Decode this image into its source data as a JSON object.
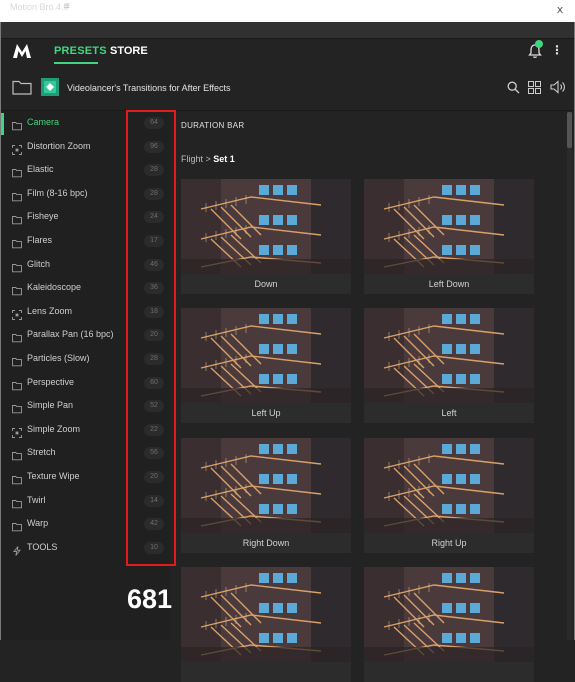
{
  "window": {
    "close_label": "x"
  },
  "panel": {
    "title": "Motion Bro 4.0",
    "menu_glyph": "≡"
  },
  "nav": {
    "logo_icon": "motion-bro-logo",
    "tabs": [
      {
        "label": "PRESETS",
        "active": true
      },
      {
        "label": "STORE",
        "active": false
      }
    ],
    "kebab_glyph": "⋮"
  },
  "product": {
    "title": "Videolancer's Transitions for After Effects"
  },
  "sidebar": {
    "items": [
      {
        "label": "Camera",
        "count": "64",
        "icon": "folder-icon",
        "active": true
      },
      {
        "label": "Distortion Zoom",
        "count": "96",
        "icon": "zoom-frame-icon"
      },
      {
        "label": "Elastic",
        "count": "28",
        "icon": "folder-icon"
      },
      {
        "label": "Film (8-16 bpc)",
        "count": "28",
        "icon": "folder-icon"
      },
      {
        "label": "Fisheye",
        "count": "24",
        "icon": "folder-icon"
      },
      {
        "label": "Flares",
        "count": "17",
        "icon": "folder-icon"
      },
      {
        "label": "Glitch",
        "count": "46",
        "icon": "folder-icon"
      },
      {
        "label": "Kaleidoscope",
        "count": "36",
        "icon": "folder-icon"
      },
      {
        "label": "Lens Zoom",
        "count": "18",
        "icon": "zoom-frame-icon"
      },
      {
        "label": "Parallax Pan (16 bpc)",
        "count": "20",
        "icon": "folder-icon"
      },
      {
        "label": "Particles (Slow)",
        "count": "28",
        "icon": "folder-icon"
      },
      {
        "label": "Perspective",
        "count": "60",
        "icon": "folder-icon"
      },
      {
        "label": "Simple Pan",
        "count": "52",
        "icon": "folder-icon"
      },
      {
        "label": "Simple Zoom",
        "count": "22",
        "icon": "zoom-frame-icon"
      },
      {
        "label": "Stretch",
        "count": "56",
        "icon": "folder-icon"
      },
      {
        "label": "Texture Wipe",
        "count": "20",
        "icon": "folder-icon"
      },
      {
        "label": "Twirl",
        "count": "14",
        "icon": "folder-icon"
      },
      {
        "label": "Warp",
        "count": "42",
        "icon": "folder-icon"
      },
      {
        "label": "TOOLS",
        "count": "10",
        "icon": "lightning-icon"
      }
    ],
    "total": "681"
  },
  "content": {
    "section_title": "DURATION BAR",
    "breadcrumb_prefix": "Flight > ",
    "breadcrumb_current": "Set 1",
    "cards": [
      {
        "label": "Down"
      },
      {
        "label": "Left Down"
      },
      {
        "label": "Left Up"
      },
      {
        "label": "Left"
      },
      {
        "label": "Right Down"
      },
      {
        "label": "Right Up"
      },
      {
        "label": ""
      },
      {
        "label": ""
      }
    ]
  },
  "colors": {
    "accent": "#3fd67f",
    "background": "#232323",
    "highlight_box": "#e51b1b"
  }
}
